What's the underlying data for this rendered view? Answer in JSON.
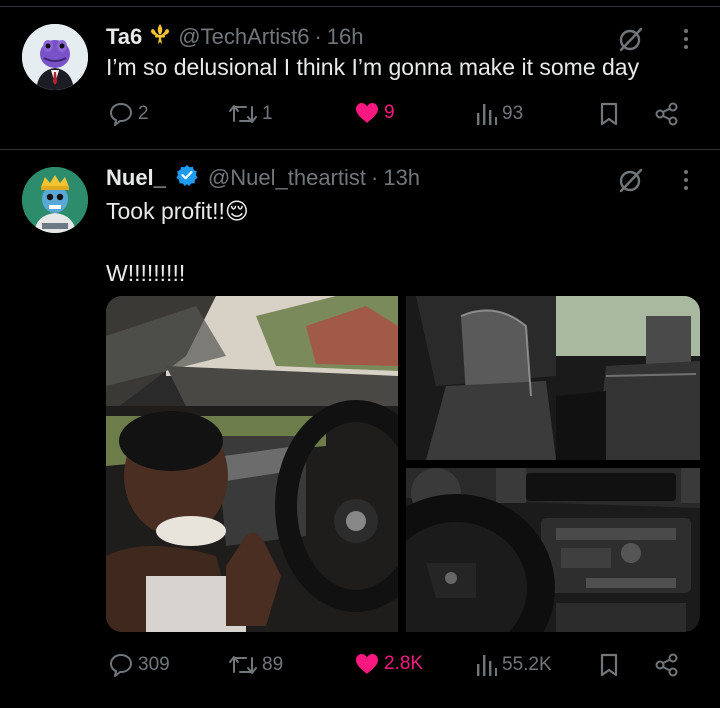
{
  "tweets": [
    {
      "display_name": "Ta6",
      "handle": "@TechArtist6",
      "time": "16h",
      "text": "I’m so delusional I think I’m gonna make it some day",
      "badge_icon": "fleur-de-lis-icon",
      "stats": {
        "replies": "2",
        "reposts": "1",
        "likes": "9",
        "views": "93"
      }
    },
    {
      "display_name": "Nuel_",
      "handle": "@Nuel_theartist",
      "time": "13h",
      "text": "Took profit!!😌",
      "text2": "W!!!!!!!!!",
      "badge_icon": "verified-check-icon",
      "stats": {
        "replies": "309",
        "reposts": "89",
        "likes": "2.8K",
        "views": "55.2K"
      }
    }
  ],
  "separator": "·",
  "colors": {
    "background": "#000000",
    "text": "#e7e9ea",
    "muted": "#71767b",
    "like": "#f91880",
    "verified": "#1d9bf0",
    "badge_gold": "#f4c430",
    "divider": "#2f3336"
  }
}
